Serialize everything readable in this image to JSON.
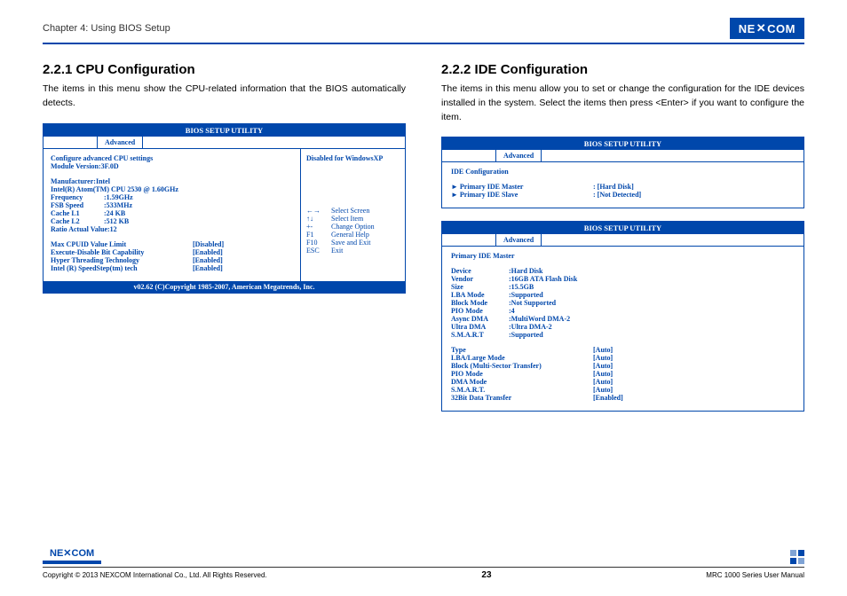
{
  "header": {
    "chapter": "Chapter 4: Using BIOS Setup",
    "brand": "NEXCOM"
  },
  "left": {
    "title": "2.2.1 CPU Configuration",
    "desc": "The items in this menu show the CPU-related information that the BIOS automatically detects.",
    "bios": {
      "title": "BIOS SETUP UTILITY",
      "tab": "Advanced",
      "right_top": "Disabled for WindowsXP",
      "heading": "Configure advanced CPU settings",
      "module": "Module Version:3F.0D",
      "info": {
        "mfr": "Manufacturer:Intel",
        "cpu": "Intel(R) Atom(TM) CPU 2530    @ 1.60GHz",
        "freq_l": "Frequency",
        "freq_v": ":1.59GHz",
        "fsb_l": "FSB Speed",
        "fsb_v": ":533MHz",
        "l1_l": "Cache L1",
        "l1_v": ":24 KB",
        "l2_l": "Cache L2",
        "l2_v": ":512 KB",
        "ratio": "Ratio Actual Value:12"
      },
      "opts": {
        "o1_l": "Max CPUID Value Limit",
        "o1_v": "[Disabled]",
        "o2_l": "Execute-Disable Bit Capability",
        "o2_v": "[Enabled]",
        "o3_l": "Hyper Threading Technology",
        "o3_v": "[Enabled]",
        "o4_l": "Intel (R) SpeedStep(tm) tech",
        "o4_v": "[Enabled]"
      },
      "help": {
        "h1_k": "←→",
        "h1_v": "Select Screen",
        "h2_k": "↑↓",
        "h2_v": "Select Item",
        "h3_k": "+-",
        "h3_v": "Change Option",
        "h4_k": "F1",
        "h4_v": "General Help",
        "h5_k": "F10",
        "h5_v": "Save and Exit",
        "h6_k": "ESC",
        "h6_v": "Exit"
      },
      "footer": "v02.62 (C)Copyright 1985-2007, American Megatrends, Inc."
    }
  },
  "right": {
    "title": "2.2.2 IDE Configuration",
    "desc": "The items in this menu allow you to set or change the configuration for the IDE devices installed in the system. Select the items then press <Enter> if you want to configure the item.",
    "bios1": {
      "title": "BIOS SETUP UTILITY",
      "tab": "Advanced",
      "heading": "IDE Configuration",
      "r1_l": "► Primary IDE Master",
      "r1_v": ": [Hard Disk]",
      "r2_l": "► Primary IDE Slave",
      "r2_v": ": [Not Detected]"
    },
    "bios2": {
      "title": "BIOS SETUP UTILITY",
      "tab": "Advanced",
      "heading": "Primary IDE Master",
      "info": {
        "dev_l": "Device",
        "dev_v": ":Hard Disk",
        "ven_l": "Vendor",
        "ven_v": ":16GB ATA Flash Disk",
        "siz_l": "Size",
        "siz_v": ":15.5GB",
        "lba_l": "LBA Mode",
        "lba_v": ":Supported",
        "blk_l": "Block Mode",
        "blk_v": ":Not Supported",
        "pio_l": "PIO Mode",
        "pio_v": ":4",
        "adm_l": "Async DMA",
        "adm_v": ":MultiWord DMA-2",
        "udm_l": "Ultra DMA",
        "udm_v": ":Ultra DMA-2",
        "sma_l": "S.M.A.R.T",
        "sma_v": ":Supported"
      },
      "opts": {
        "t1_l": "Type",
        "t1_v": "[Auto]",
        "t2_l": "LBA/Large Mode",
        "t2_v": "[Auto]",
        "t3_l": "Block (Multi-Sector Transfer)",
        "t3_v": "[Auto]",
        "t4_l": "PIO Mode",
        "t4_v": "[Auto]",
        "t5_l": "DMA Mode",
        "t5_v": "[Auto]",
        "t6_l": "S.M.A.R.T.",
        "t6_v": "[Auto]",
        "t7_l": "32Bit Data Transfer",
        "t7_v": "[Enabled]"
      }
    }
  },
  "footer": {
    "copyright": "Copyright © 2013 NEXCOM International Co., Ltd. All Rights Reserved.",
    "page": "23",
    "manual": "MRC 1000 Series User Manual",
    "brand": "NEXCOM"
  }
}
